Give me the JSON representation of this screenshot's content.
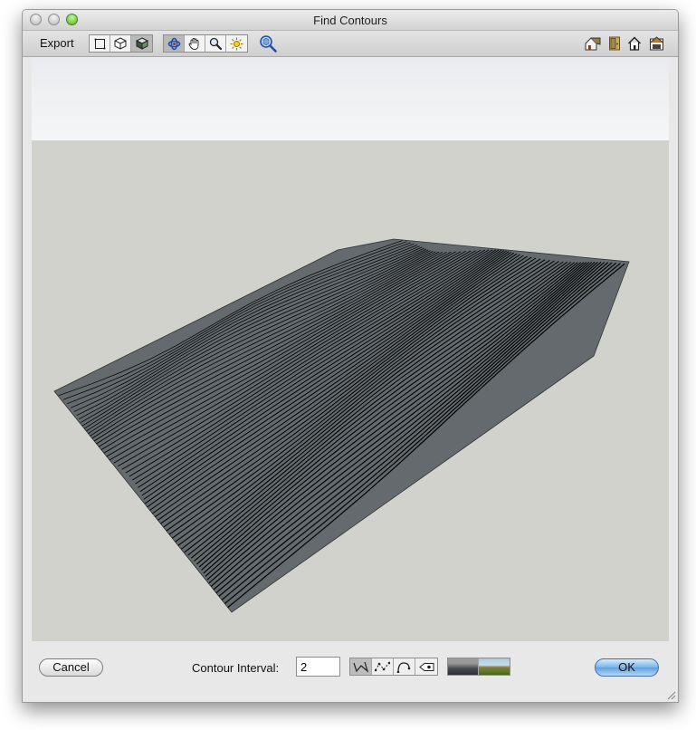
{
  "window": {
    "title": "Find Contours",
    "traffic_lights": [
      "close",
      "minimize",
      "zoom"
    ]
  },
  "toolbar": {
    "export_label": "Export",
    "view_modes": [
      "wireframe-icon",
      "hidden-line-icon",
      "shaded-icon"
    ],
    "active_view_mode": "shaded-icon",
    "nav_tools": [
      "orbit-icon",
      "pan-hand-icon",
      "zoom-magnifier-icon",
      "sun-light-icon"
    ],
    "zoom_extents_icon": "zoom-extents-icon",
    "right_icons": [
      "house-icon",
      "door-icon",
      "home-icon",
      "save-house-icon"
    ]
  },
  "viewport": {
    "content": "3D terrain contour preview",
    "background_color": "#d2d2cc",
    "sky_color": "#eef0f2",
    "terrain_color": "#646a6e",
    "contour_color": "#000000"
  },
  "bottom_bar": {
    "cancel_label": "Cancel",
    "contour_interval_label": "Contour Interval:",
    "contour_interval_value": "2",
    "line_style_icons": [
      "polyline-icon",
      "dotted-curve-icon",
      "smooth-curve-icon",
      "label-tag-icon"
    ],
    "active_line_style": "polyline-icon",
    "render_thumbs": [
      "dark-surface-thumbnail",
      "colored-terrain-thumbnail"
    ],
    "ok_label": "OK"
  }
}
